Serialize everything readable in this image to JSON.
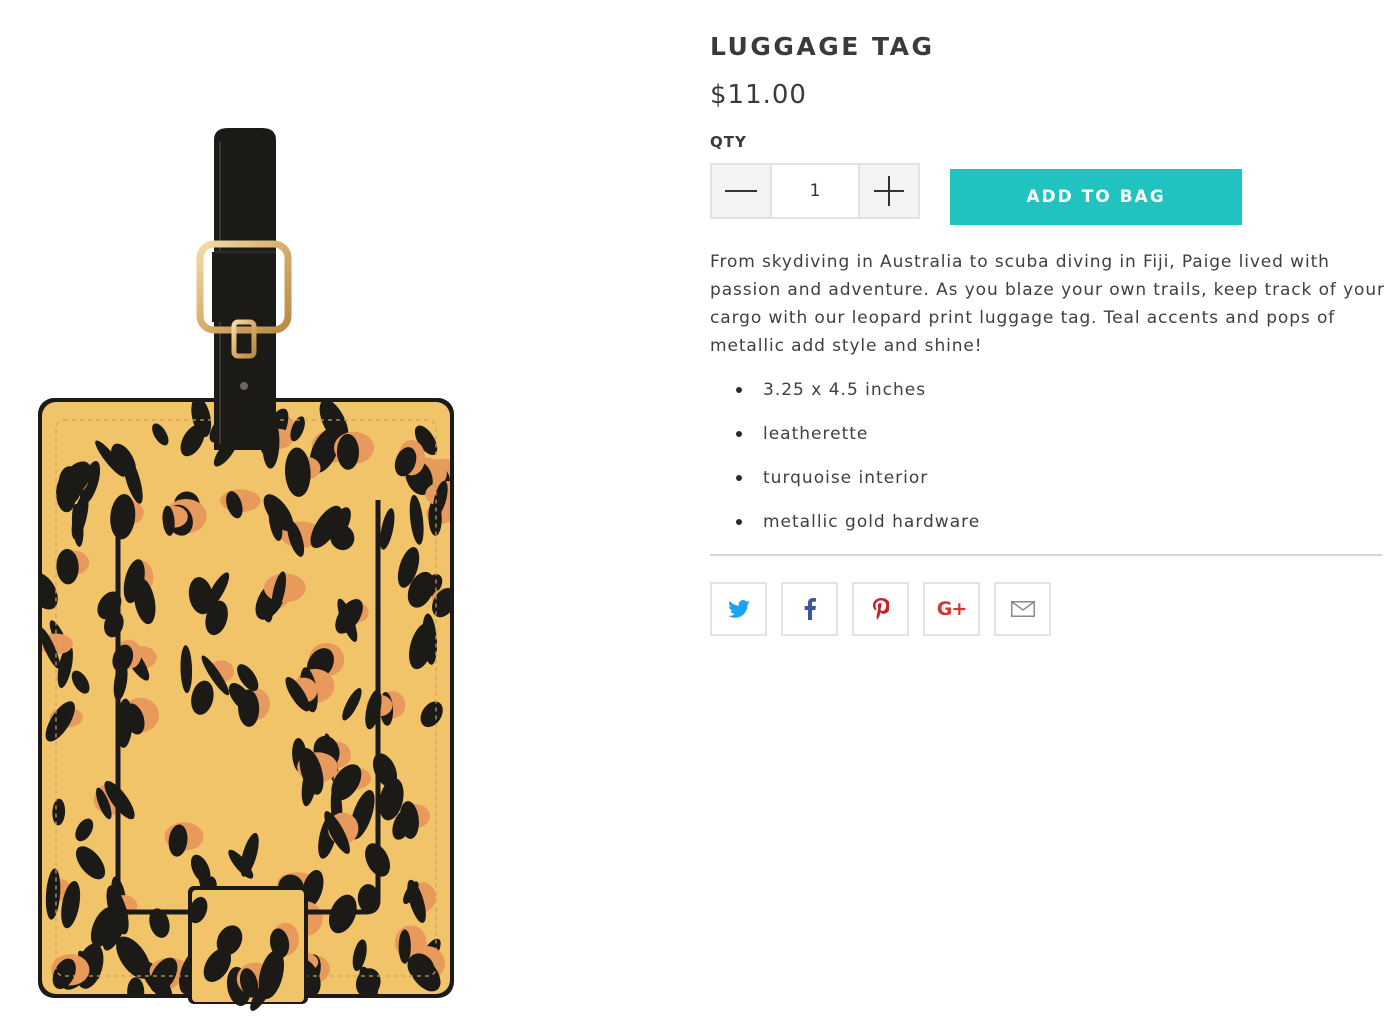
{
  "product": {
    "title": "LUGGAGE TAG",
    "price": "$11.00",
    "image_alt": "Leopard print luggage tag with black strap and gold buckle"
  },
  "purchase": {
    "qty_label": "QTY",
    "qty_value": "1",
    "add_to_bag_label": "ADD TO BAG"
  },
  "description": "From skydiving in Australia to scuba diving in Fiji, Paige lived with passion and adventure. As you blaze your own trails, keep track of your cargo with our leopard print luggage tag. Teal accents and pops of metallic add style and shine!",
  "features": [
    "3.25 x 4.5 inches",
    "leatherette",
    "turquoise interior",
    "metallic gold hardware"
  ],
  "share": {
    "icons": [
      "twitter-icon",
      "facebook-icon",
      "pinterest-icon",
      "google-plus-icon",
      "email-icon"
    ],
    "google_plus_glyph": "G+"
  },
  "colors": {
    "accent": "#21c3c1",
    "twitter": "#1da1f2",
    "facebook": "#3b5998",
    "pinterest": "#cb2027",
    "google_plus": "#d23a2e",
    "email": "#8a8a8a",
    "leopard_base": "#f2c46a",
    "leopard_spot": "#1c1a17",
    "leopard_accent": "#e79a5b",
    "buckle_gold": "#d6ad6a"
  }
}
